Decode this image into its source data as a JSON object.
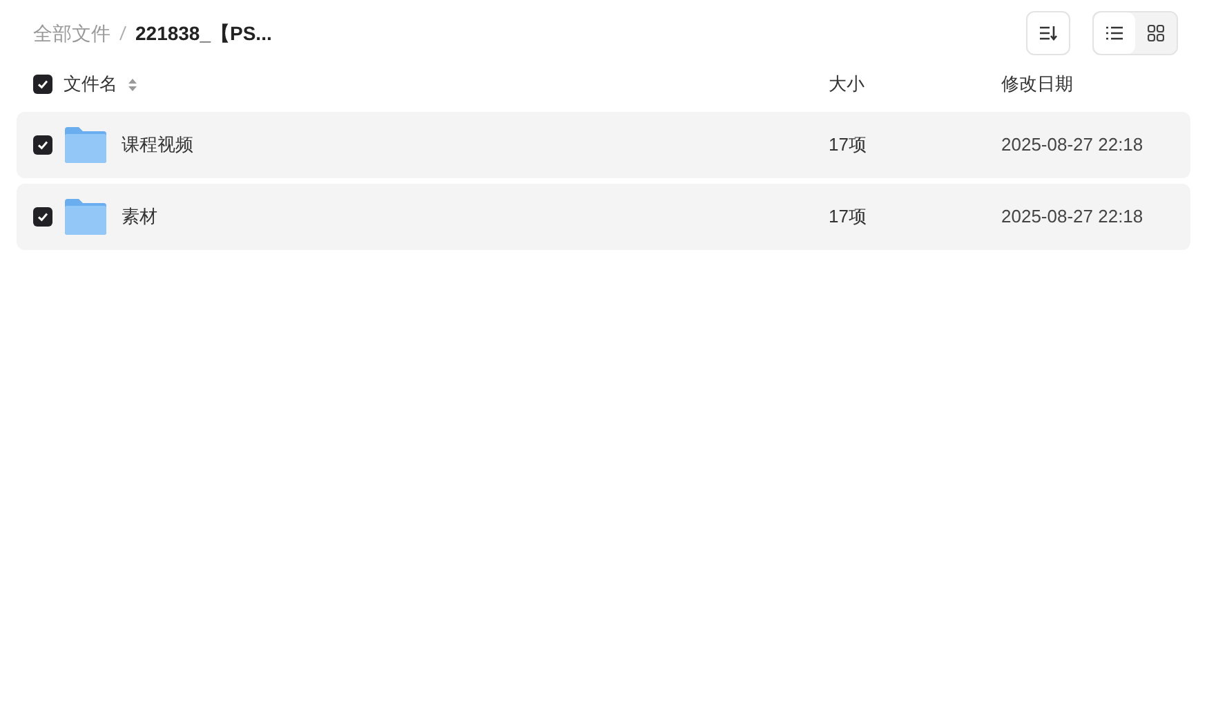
{
  "breadcrumb": [
    {
      "label": "全部文件",
      "current": false
    },
    {
      "label": "221838_【PS...",
      "current": true
    }
  ],
  "toolbar": {
    "view_modes": [
      {
        "kind": "list",
        "selected": true
      },
      {
        "kind": "grid",
        "selected": false
      }
    ]
  },
  "header": {
    "checked": true,
    "columns": [
      "文件名",
      "大小",
      "修改日期"
    ]
  },
  "rows": [
    {
      "checked": true,
      "name": "课程视频",
      "size": "17项",
      "modified": "2025-08-27 22:18"
    },
    {
      "checked": true,
      "name": "素材",
      "size": "17项",
      "modified": "2025-08-27 22:18"
    }
  ]
}
